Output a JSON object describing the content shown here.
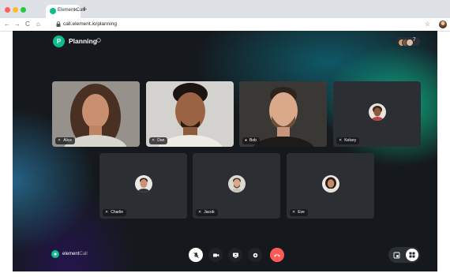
{
  "browser": {
    "tab_title": "Element Call",
    "tab_close": "×",
    "new_tab": "+",
    "nav_back": "←",
    "nav_forward": "→",
    "nav_reload": "C",
    "nav_home": "⌂",
    "url": "call.element.io/planning",
    "lock": "🔒",
    "star": "☆"
  },
  "room": {
    "avatar_letter": "P",
    "name": "Planning",
    "participant_count": "7"
  },
  "tiles": [
    {
      "name": "Alice",
      "muted": true,
      "video": true
    },
    {
      "name": "Dan",
      "muted": true,
      "video": true
    },
    {
      "name": "Bob",
      "muted": false,
      "video": true,
      "speaking": true
    },
    {
      "name": "Kelsey",
      "muted": true,
      "video": false
    },
    {
      "name": "Charlie",
      "muted": true,
      "video": false
    },
    {
      "name": "Jacob",
      "muted": true,
      "video": false
    },
    {
      "name": "Eve",
      "muted": true,
      "video": false
    }
  ],
  "logo": {
    "brand": "element",
    "product": "Call"
  },
  "colors": {
    "accent": "#0dbd8b",
    "hangup": "#ff5b55",
    "tile": "#2b2e33"
  },
  "icons": {
    "mic_muted": "🎙̸",
    "mic": "🎙"
  }
}
